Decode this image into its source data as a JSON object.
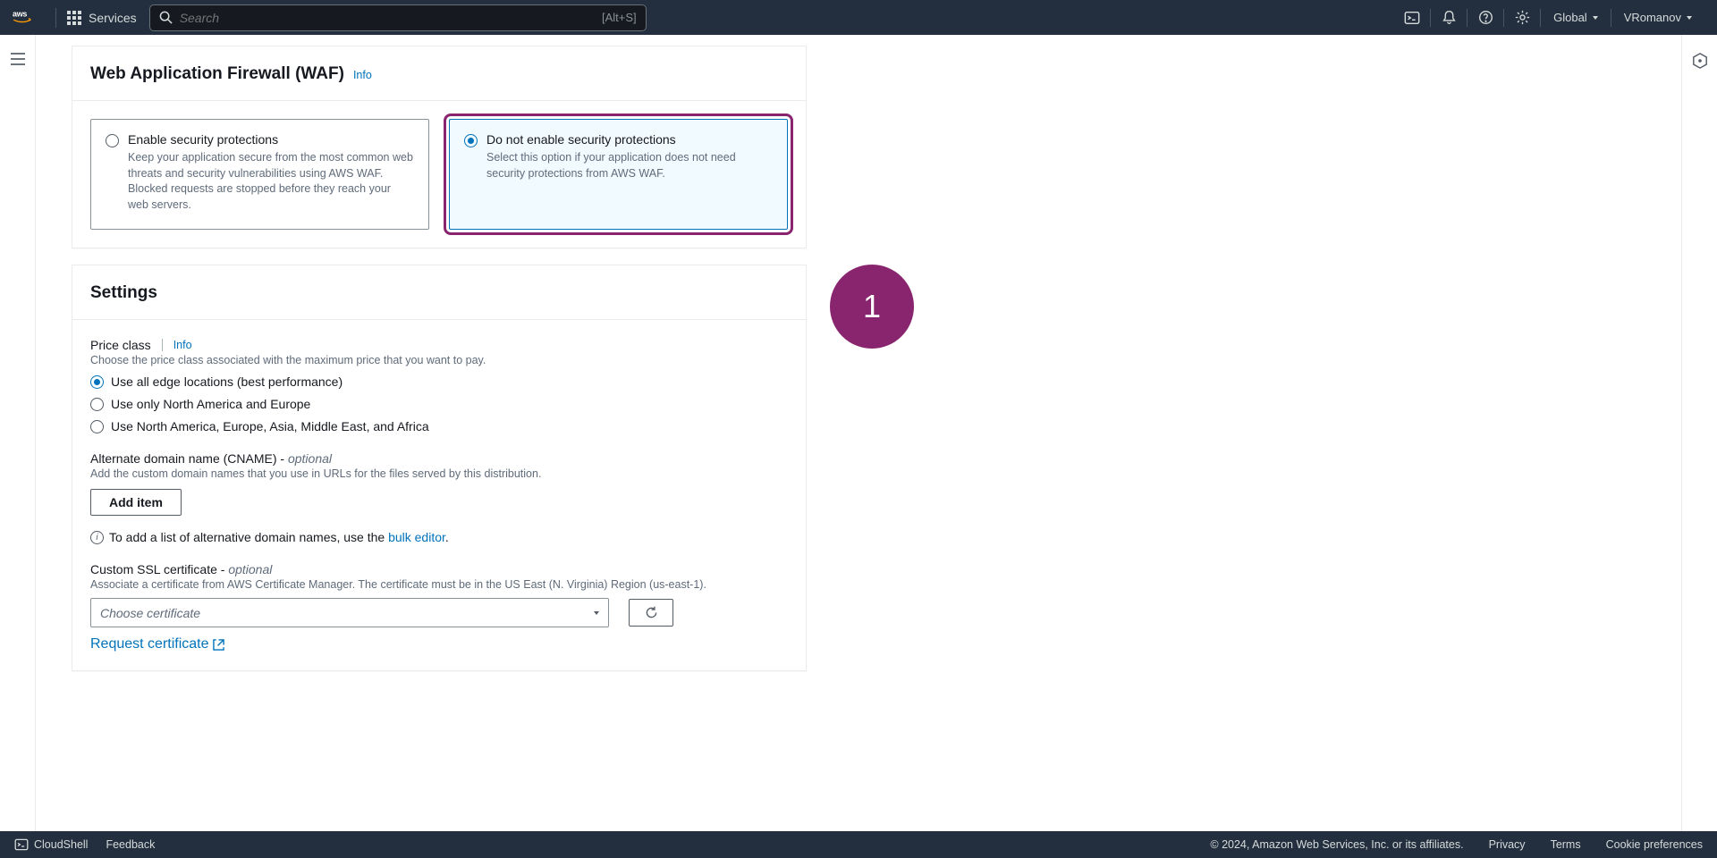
{
  "nav": {
    "services_label": "Services",
    "search_placeholder": "Search",
    "search_hint": "[Alt+S]",
    "region": "Global",
    "user": "VRomanov"
  },
  "waf": {
    "title": "Web Application Firewall (WAF)",
    "info": "Info",
    "selected": 1,
    "options": [
      {
        "title": "Enable security protections",
        "desc": "Keep your application secure from the most common web threats and security vulnerabilities using AWS WAF. Blocked requests are stopped before they reach your web servers."
      },
      {
        "title": "Do not enable security protections",
        "desc": "Select this option if your application does not need security protections from AWS WAF."
      }
    ]
  },
  "settings": {
    "title": "Settings",
    "price_class": {
      "label": "Price class",
      "info": "Info",
      "desc": "Choose the price class associated with the maximum price that you want to pay.",
      "selected": 0,
      "options": [
        "Use all edge locations (best performance)",
        "Use only North America and Europe",
        "Use North America, Europe, Asia, Middle East, and Africa"
      ]
    },
    "cname": {
      "label_prefix": "Alternate domain name (CNAME) - ",
      "label_suffix": "optional",
      "desc": "Add the custom domain names that you use in URLs for the files served by this distribution.",
      "add_button": "Add item",
      "hint_prefix": "To add a list of alternative domain names, use the ",
      "hint_link": "bulk editor",
      "hint_suffix": "."
    },
    "ssl": {
      "label_prefix": "Custom SSL certificate - ",
      "label_suffix": "optional",
      "desc": "Associate a certificate from AWS Certificate Manager. The certificate must be in the US East (N. Virginia) Region (us-east-1).",
      "placeholder": "Choose certificate",
      "request_link": "Request certificate"
    }
  },
  "annotation": {
    "badge": "1"
  },
  "footer": {
    "cloudshell": "CloudShell",
    "feedback": "Feedback",
    "copyright": "© 2024, Amazon Web Services, Inc. or its affiliates.",
    "privacy": "Privacy",
    "terms": "Terms",
    "cookies": "Cookie preferences"
  }
}
